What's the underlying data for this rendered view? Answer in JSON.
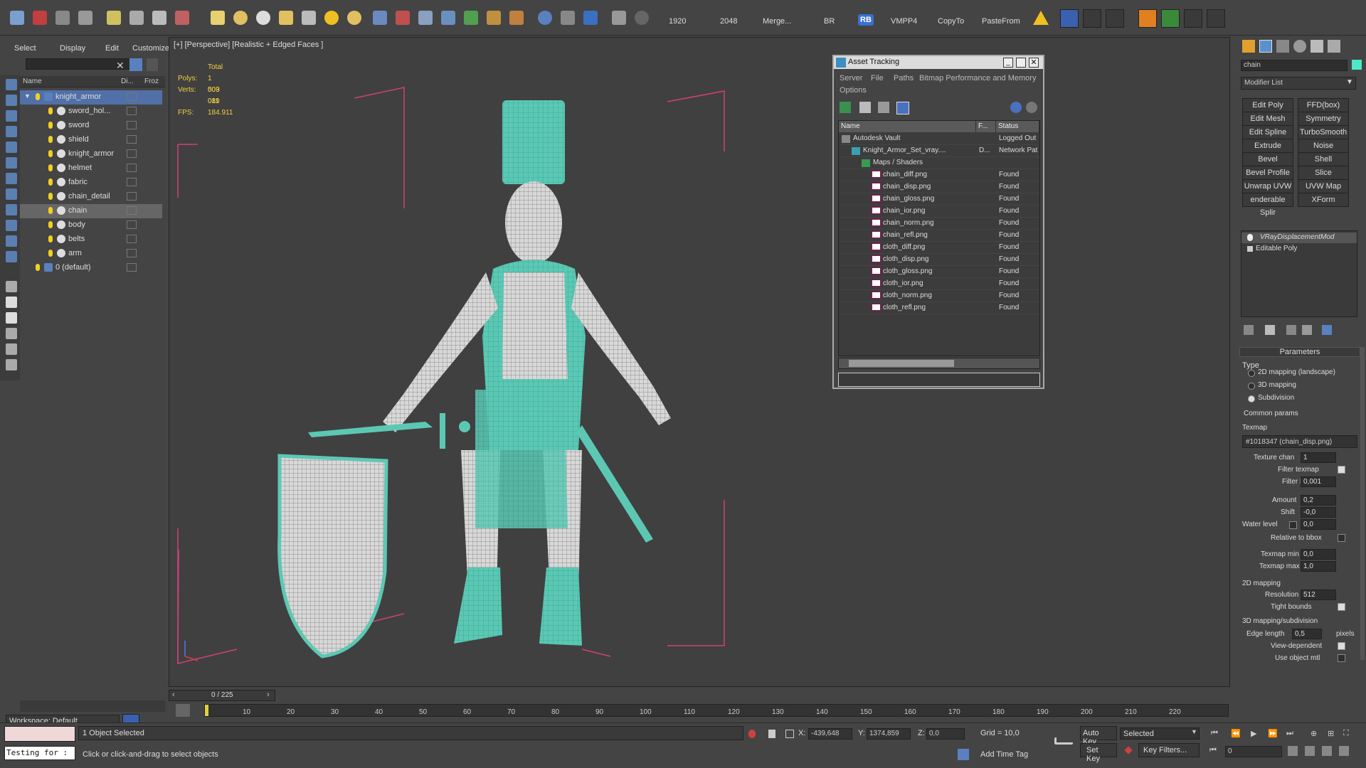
{
  "toolbar": {
    "items": [
      "1920",
      "2048",
      "Merge...",
      "BR",
      "RB",
      "VMPP4",
      "CopyTo",
      "PasteFrom"
    ]
  },
  "explorer": {
    "menu": [
      "Select",
      "Display",
      "Edit",
      "Customize"
    ],
    "columns": [
      "Name",
      "Di...",
      "Froz"
    ],
    "tree": [
      {
        "label": "knight_armor",
        "level": 0,
        "selected": true
      },
      {
        "label": "sword_hol...",
        "level": 1
      },
      {
        "label": "sword",
        "level": 1
      },
      {
        "label": "shield",
        "level": 1
      },
      {
        "label": "knight_armor",
        "level": 1
      },
      {
        "label": "helmet",
        "level": 1
      },
      {
        "label": "fabric",
        "level": 1
      },
      {
        "label": "chain_detail",
        "level": 1
      },
      {
        "label": "chain",
        "level": 1,
        "highlighted": true
      },
      {
        "label": "body",
        "level": 1
      },
      {
        "label": "belts",
        "level": 1
      },
      {
        "label": "arm",
        "level": 1
      },
      {
        "label": "0 (default)",
        "level": 0
      }
    ],
    "workspace": "Workspace: Default"
  },
  "viewport": {
    "label": "[+] [Perspective] [Realistic + Edged Faces ]",
    "stats": {
      "total_label": "Total",
      "polys_label": "Polys:",
      "polys": "1 003 011",
      "verts_label": "Verts:",
      "verts": "509 089",
      "fps_label": "FPS:",
      "fps": "184.911"
    }
  },
  "asset_tracking": {
    "title": "Asset Tracking",
    "menu": [
      "Server",
      "File",
      "Paths",
      "Bitmap Performance and Memory",
      "Options"
    ],
    "columns": [
      "Name",
      "F...",
      "Status"
    ],
    "rows": [
      {
        "name": "Autodesk Vault",
        "f": "",
        "status": "Logged Out",
        "indent": 0
      },
      {
        "name": "Knight_Armor_Set_vray....",
        "f": "D...",
        "status": "Network Pat",
        "indent": 1
      },
      {
        "name": "Maps / Shaders",
        "f": "",
        "status": "",
        "indent": 2
      },
      {
        "name": "chain_diff.png",
        "f": "",
        "status": "Found",
        "indent": 3
      },
      {
        "name": "chain_disp.png",
        "f": "",
        "status": "Found",
        "indent": 3
      },
      {
        "name": "chain_gloss.png",
        "f": "",
        "status": "Found",
        "indent": 3
      },
      {
        "name": "chain_ior.png",
        "f": "",
        "status": "Found",
        "indent": 3
      },
      {
        "name": "chain_norm.png",
        "f": "",
        "status": "Found",
        "indent": 3
      },
      {
        "name": "chain_refl.png",
        "f": "",
        "status": "Found",
        "indent": 3
      },
      {
        "name": "cloth_diff.png",
        "f": "",
        "status": "Found",
        "indent": 3
      },
      {
        "name": "cloth_disp.png",
        "f": "",
        "status": "Found",
        "indent": 3
      },
      {
        "name": "cloth_gloss.png",
        "f": "",
        "status": "Found",
        "indent": 3
      },
      {
        "name": "cloth_ior.png",
        "f": "",
        "status": "Found",
        "indent": 3
      },
      {
        "name": "cloth_norm.png",
        "f": "",
        "status": "Found",
        "indent": 3
      },
      {
        "name": "cloth_refl.png",
        "f": "",
        "status": "Found",
        "indent": 3
      }
    ]
  },
  "command_panel": {
    "object_name": "chain",
    "modifier_list": "Modifier List",
    "buttons": [
      "Edit Poly",
      "FFD(box)",
      "Edit Mesh",
      "Symmetry",
      "Edit Spline",
      "TurboSmooth",
      "Extrude",
      "Noise",
      "Bevel",
      "Shell",
      "Bevel Profile",
      "Slice",
      "Unwrap UVW",
      "UVW Map",
      "enderable Splir",
      "XForm"
    ],
    "stack": [
      "VRayDisplacementMod",
      "Editable Poly"
    ],
    "parameters_title": "Parameters",
    "type_label": "Type",
    "type_options": [
      "2D mapping (landscape)",
      "3D mapping",
      "Subdivision"
    ],
    "type_selected": "Subdivision",
    "common_params": "Common params",
    "texmap_label": "Texmap",
    "texmap_value": "#1018347 (chain_disp.png)",
    "texture_chan_label": "Texture chan",
    "texture_chan": "1",
    "filter_texmap_label": "Filter texmap",
    "filter_blur_label": "Filter blur",
    "filter_blur": "0,001",
    "amount_label": "Amount",
    "amount": "0,2",
    "shift_label": "Shift",
    "shift": "-0,0",
    "water_level_label": "Water level",
    "water_level": "0,0",
    "relative_bbox_label": "Relative to bbox",
    "texmap_min_label": "Texmap min",
    "texmap_min": "0,0",
    "texmap_max_label": "Texmap max",
    "texmap_max": "1,0",
    "mapping2d_title": "2D mapping",
    "resolution_label": "Resolution",
    "resolution": "512",
    "tight_bounds_label": "Tight bounds",
    "mapping3d_title": "3D mapping/subdivision",
    "edge_length_label": "Edge length",
    "edge_length": "0,5",
    "pixels_label": "pixels",
    "view_dependent_label": "View-dependent",
    "use_object_mtl_label": "Use object mtl"
  },
  "timeline": {
    "frame": "0 / 225",
    "ticks": [
      "10",
      "20",
      "30",
      "40",
      "50",
      "60",
      "70",
      "80",
      "90",
      "100",
      "110",
      "120",
      "130",
      "140",
      "150",
      "160",
      "170",
      "180",
      "190",
      "200",
      "210",
      "220"
    ]
  },
  "status": {
    "script_text": "Testing for :",
    "selected": "1 Object Selected",
    "prompt": "Click or click-and-drag to select objects",
    "x_label": "X:",
    "x": "-439,648",
    "y_label": "Y:",
    "y": "1374,859",
    "z_label": "Z:",
    "z": "0,0",
    "grid": "Grid = 10,0",
    "add_time_tag": "Add Time Tag",
    "auto_key": "Auto Key",
    "set_key": "Set Key",
    "selected_dropdown": "Selected",
    "key_filters": "Key Filters...",
    "frame_value": "0"
  },
  "colors": {
    "wire": "#4de8c8",
    "bbox": "#d0407a",
    "stats": "#f0d040",
    "selection": "#5170a8"
  }
}
